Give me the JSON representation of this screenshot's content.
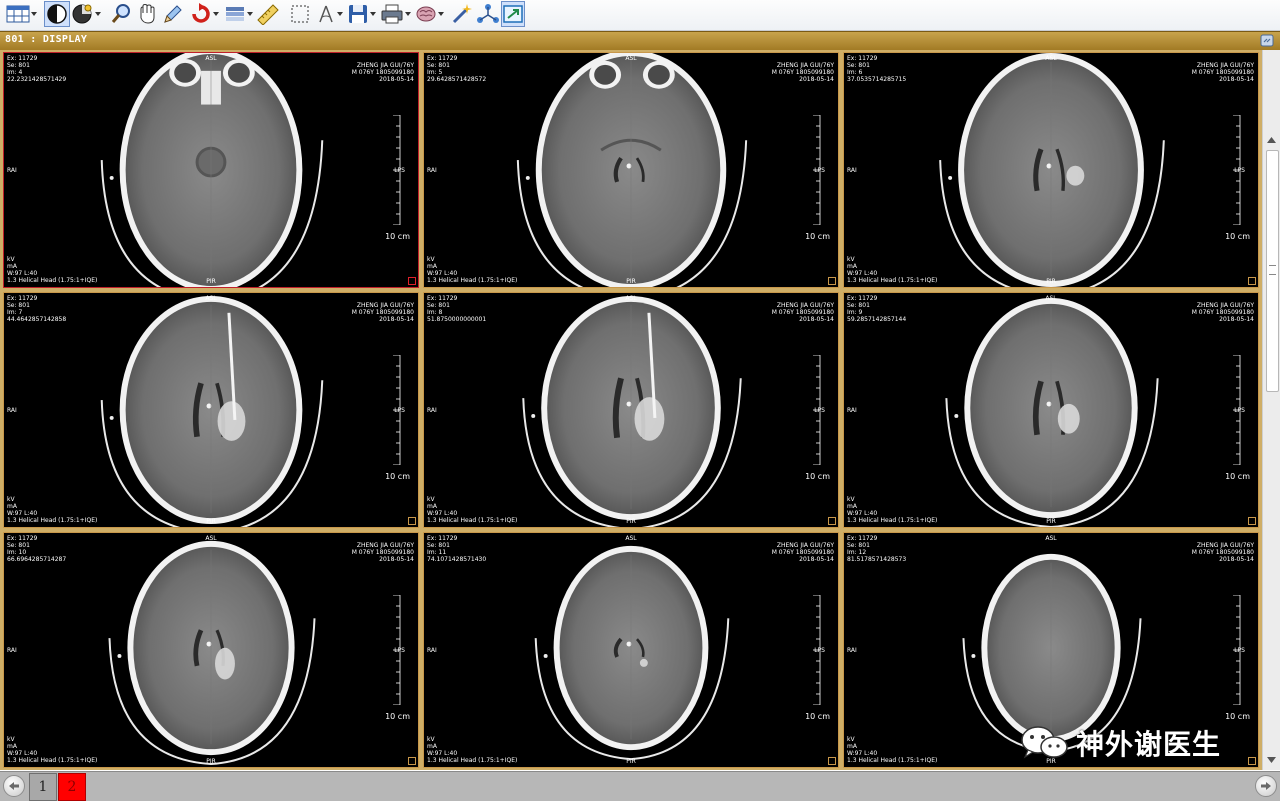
{
  "toolbar": {
    "buttons": [
      {
        "icon": "layout-grid-icon"
      },
      {
        "icon": "window-level-icon"
      },
      {
        "icon": "color-palette-icon"
      },
      {
        "icon": "zoom-magnifier-icon"
      },
      {
        "icon": "pan-hand-icon"
      },
      {
        "icon": "pencil-annotate-icon"
      },
      {
        "icon": "rotate-icon"
      },
      {
        "icon": "layers-icon"
      },
      {
        "icon": "ruler-measure-icon"
      },
      {
        "icon": "region-select-icon"
      },
      {
        "icon": "angle-measure-icon"
      },
      {
        "icon": "save-disk-icon"
      },
      {
        "icon": "print-icon"
      },
      {
        "icon": "brain-3d-icon"
      },
      {
        "icon": "magic-wand-icon"
      },
      {
        "icon": "network-link-icon"
      },
      {
        "icon": "fullscreen-export-icon"
      }
    ]
  },
  "display": {
    "title": "801 : DISPLAY"
  },
  "viewer": {
    "colors": {
      "frame": "#c8974a",
      "active_frame": "#c0202a",
      "background": "#000000",
      "bar": "#b48c35"
    },
    "images": [
      {
        "exam": "Ex: 11729",
        "series": "Se: 801",
        "image": "Im: 4",
        "position": "22.2321428571429",
        "patient": "ZHENG JIA GUI/76Y",
        "id": "M 076Y 1805099180",
        "date": "2018-05-14",
        "kv": "kV",
        "ma": "mA",
        "window": "W:97 L:40",
        "protocol": "1.3 Helical Head (1.75:1+IQE)",
        "orient_top": "ASL",
        "orient_bottom": "PIR",
        "orient_left": "RAI",
        "orient_right": "LPS",
        "scale": "10 cm",
        "active": true
      },
      {
        "exam": "Ex: 11729",
        "series": "Se: 801",
        "image": "Im: 5",
        "position": "29.6428571428572",
        "patient": "ZHENG JIA GUI/76Y",
        "id": "M 076Y 1805099180",
        "date": "2018-05-14",
        "kv": "kV",
        "ma": "mA",
        "window": "W:97 L:40",
        "protocol": "1.3 Helical Head (1.75:1+IQE)",
        "orient_top": "ASL",
        "orient_bottom": "PIR",
        "orient_left": "RAI",
        "orient_right": "LPS",
        "scale": "10 cm",
        "active": false
      },
      {
        "exam": "Ex: 11729",
        "series": "Se: 801",
        "image": "Im: 6",
        "position": "37.0535714285715",
        "patient": "ZHENG JIA GUI/76Y",
        "id": "M 076Y 1805099180",
        "date": "2018-05-14",
        "kv": "kV",
        "ma": "mA",
        "window": "W:97 L:40",
        "protocol": "1.3 Helical Head (1.75:1+IQE)",
        "orient_top": "ASL",
        "orient_bottom": "PIR",
        "orient_left": "RAI",
        "orient_right": "LPS",
        "scale": "10 cm",
        "active": false
      },
      {
        "exam": "Ex: 11729",
        "series": "Se: 801",
        "image": "Im: 7",
        "position": "44.4642857142858",
        "patient": "ZHENG JIA GUI/76Y",
        "id": "M 076Y 1805099180",
        "date": "2018-05-14",
        "kv": "kV",
        "ma": "mA",
        "window": "W:97 L:40",
        "protocol": "1.3 Helical Head (1.75:1+IQE)",
        "orient_top": "ASL",
        "orient_bottom": "PIR",
        "orient_left": "RAI",
        "orient_right": "LPS",
        "scale": "10 cm",
        "active": false
      },
      {
        "exam": "Ex: 11729",
        "series": "Se: 801",
        "image": "Im: 8",
        "position": "51.8750000000001",
        "patient": "ZHENG JIA GUI/76Y",
        "id": "M 076Y 1805099180",
        "date": "2018-05-14",
        "kv": "kV",
        "ma": "mA",
        "window": "W:97 L:40",
        "protocol": "1.3 Helical Head (1.75:1+IQE)",
        "orient_top": "ASL",
        "orient_bottom": "PIR",
        "orient_left": "RAI",
        "orient_right": "LPS",
        "scale": "10 cm",
        "active": false
      },
      {
        "exam": "Ex: 11729",
        "series": "Se: 801",
        "image": "Im: 9",
        "position": "59.2857142857144",
        "patient": "ZHENG JIA GUI/76Y",
        "id": "M 076Y 1805099180",
        "date": "2018-05-14",
        "kv": "kV",
        "ma": "mA",
        "window": "W:97 L:40",
        "protocol": "1.3 Helical Head (1.75:1+IQE)",
        "orient_top": "ASL",
        "orient_bottom": "PIR",
        "orient_left": "RAI",
        "orient_right": "LPS",
        "scale": "10 cm",
        "active": false
      },
      {
        "exam": "Ex: 11729",
        "series": "Se: 801",
        "image": "Im: 10",
        "position": "66.6964285714287",
        "patient": "ZHENG JIA GUI/76Y",
        "id": "M 076Y 1805099180",
        "date": "2018-05-14",
        "kv": "kV",
        "ma": "mA",
        "window": "W:97 L:40",
        "protocol": "1.3 Helical Head (1.75:1+IQE)",
        "orient_top": "ASL",
        "orient_bottom": "PIR",
        "orient_left": "RAI",
        "orient_right": "LPS",
        "scale": "10 cm",
        "active": false
      },
      {
        "exam": "Ex: 11729",
        "series": "Se: 801",
        "image": "Im: 11",
        "position": "74.1071428571430",
        "patient": "ZHENG JIA GUI/76Y",
        "id": "M 076Y 1805099180",
        "date": "2018-05-14",
        "kv": "kV",
        "ma": "mA",
        "window": "W:97 L:40",
        "protocol": "1.3 Helical Head (1.75:1+IQE)",
        "orient_top": "ASL",
        "orient_bottom": "PIR",
        "orient_left": "RAI",
        "orient_right": "LPS",
        "scale": "10 cm",
        "active": false
      },
      {
        "exam": "Ex: 11729",
        "series": "Se: 801",
        "image": "Im: 12",
        "position": "81.5178571428573",
        "patient": "ZHENG JIA GUI/76Y",
        "id": "M 076Y 1805099180",
        "date": "2018-05-14",
        "kv": "kV",
        "ma": "mA",
        "window": "W:97 L:40",
        "protocol": "1.3 Helical Head (1.75:1+IQE)",
        "orient_top": "ASL",
        "orient_bottom": "PIR",
        "orient_left": "RAI",
        "orient_right": "LPS",
        "scale": "10 cm",
        "active": false
      }
    ]
  },
  "pager": {
    "pages": [
      "1",
      "2"
    ],
    "current": "2",
    "prev_icon": "arrow-left-icon",
    "next_icon": "arrow-right-icon",
    "current_color": "#ff0000"
  },
  "watermark": {
    "text": "神外谢医生",
    "icon": "wechat-icon"
  }
}
